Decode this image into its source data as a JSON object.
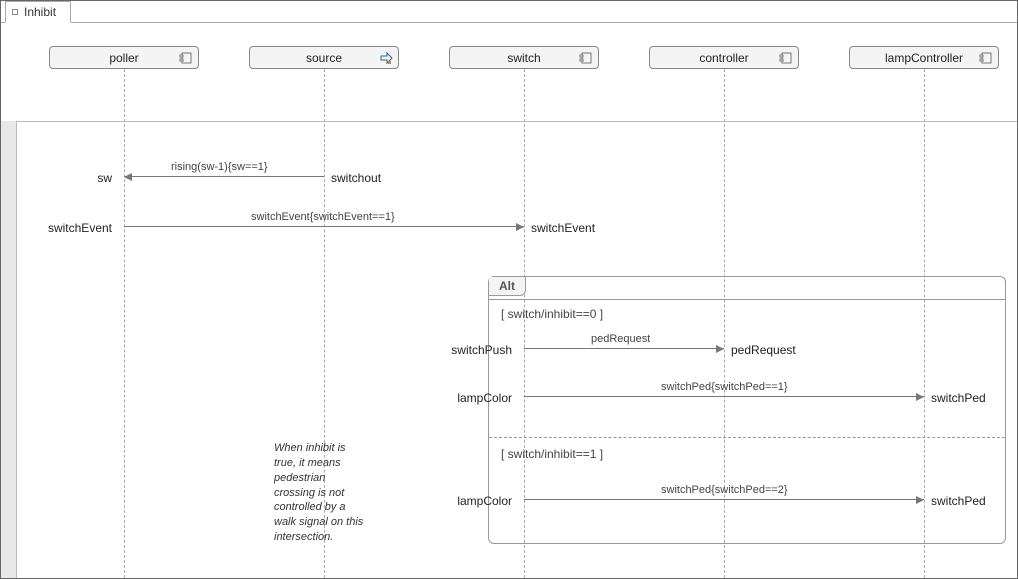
{
  "tab": {
    "label": "Inhibit"
  },
  "lifelines": {
    "poller": {
      "label": "poller"
    },
    "source": {
      "label": "source"
    },
    "switch": {
      "label": "switch"
    },
    "controller": {
      "label": "controller"
    },
    "lampController": {
      "label": "lampController"
    }
  },
  "messages": {
    "m1": {
      "label": "rising(sw-1){sw==1}",
      "from": "source",
      "from_port": "switchout",
      "to": "poller",
      "to_port": "sw"
    },
    "m2": {
      "label": "switchEvent{switchEvent==1}",
      "from": "poller",
      "from_port": "switchEvent",
      "to": "switch",
      "to_port": "switchEvent"
    },
    "m3": {
      "label": "pedRequest",
      "from": "switch",
      "from_port": "switchPush",
      "to": "controller",
      "to_port": "pedRequest"
    },
    "m4": {
      "label": "switchPed{switchPed==1}",
      "from": "switch",
      "from_port": "lampColor",
      "to": "lampController",
      "to_port": "switchPed"
    },
    "m5": {
      "label": "switchPed{switchPed==2}",
      "from": "switch",
      "from_port": "lampColor",
      "to": "lampController",
      "to_port": "switchPed"
    }
  },
  "alt": {
    "label": "Alt",
    "guards": {
      "g1": "[ switch/inhibit==0 ]",
      "g2": "[ switch/inhibit==1 ]"
    }
  },
  "note": {
    "text": "When inhibit is true, it means pedestrian crossing is not controlled by a walk signal on this intersection."
  }
}
